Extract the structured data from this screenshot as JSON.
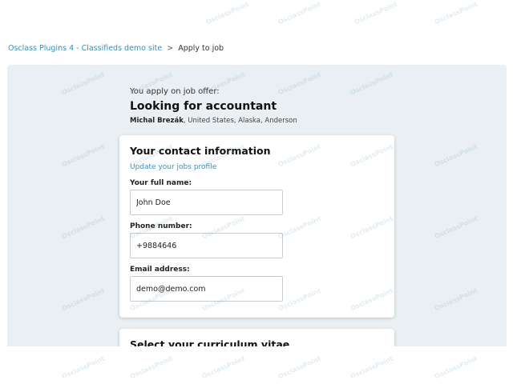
{
  "breadcrumb": {
    "site_link": "Osclass Plugins 4 - Classifieds demo site",
    "separator": ">",
    "current": "Apply to job"
  },
  "offer": {
    "intro": "You apply on job offer:",
    "title": "Looking for accountant",
    "author": "Michal Brezák",
    "location": ", United States, Alaska, Anderson"
  },
  "contact": {
    "heading": "Your contact information",
    "update_link": "Update your jobs profile",
    "fields": [
      {
        "label": "Your full name:",
        "value": "John Doe"
      },
      {
        "label": "Phone number:",
        "value": "+9884646"
      },
      {
        "label": "Email address:",
        "value": "demo@demo.com"
      }
    ]
  },
  "cv": {
    "heading": "Select your curriculum vitae"
  },
  "watermark": {
    "text": "OsclassPoint"
  }
}
